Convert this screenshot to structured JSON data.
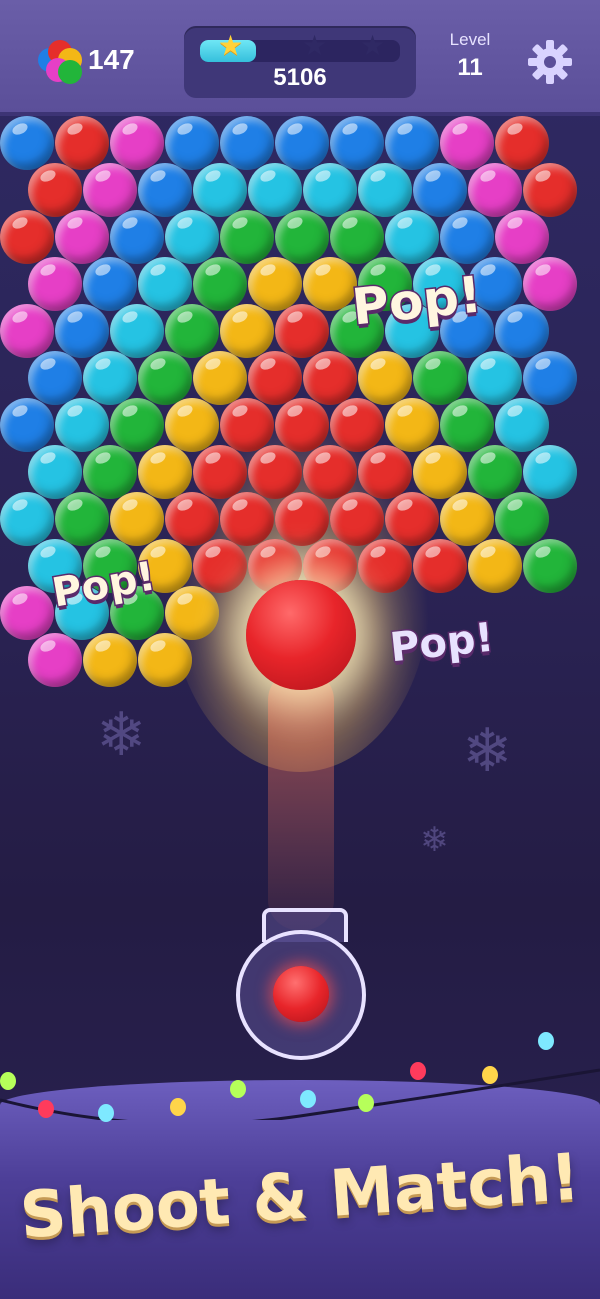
{
  "hud": {
    "coins": "147",
    "score": "5106",
    "level_label": "Level",
    "level_value": "11",
    "progress": 0.28,
    "stars_earned": 1,
    "stars_total": 3
  },
  "board": {
    "colors": {
      "B": "#1f7fe6",
      "R": "#e52e2b",
      "P": "#e63fc6",
      "C": "#25c3e3",
      "G": "#22b53a",
      "Y": "#f3b716"
    },
    "rows": [
      "BRPBBBBBPRB",
      "RPBCCCCBPR",
      "RPBCGGGCBPR",
      "PBCGYYGCBP",
      "PBCGYRGCBBP",
      "BCGYRRYGCB",
      "BCGYRRRYGCB",
      "CGYRRRRYGC",
      "CGYRRRRRYGC",
      "CGYRRRRRYGC",
      "PCGY......GP",
      "PYY.......YP"
    ],
    "pop_labels": [
      "Pop!",
      "Pop!",
      "Pop!"
    ]
  },
  "shooter": {
    "current_ball_color": "red",
    "loaded_ball_color": "red"
  },
  "banner": {
    "slogan": "Shoot & Match!"
  },
  "icons": {
    "coins": "bubble-cluster-icon",
    "settings": "gear-icon",
    "star": "star-icon"
  }
}
